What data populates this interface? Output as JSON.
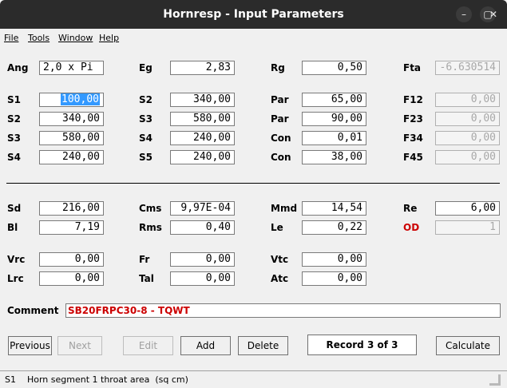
{
  "window": {
    "title": "Hornresp - Input Parameters",
    "controls": [
      "–",
      "▢",
      "✕"
    ]
  },
  "menu": [
    "File",
    "Tools",
    "Window",
    "Help"
  ],
  "params": {
    "Ang": "2,0 x Pi",
    "Eg": "2,83",
    "Rg": "0,50",
    "Fta": "-6.630514",
    "col1": [
      {
        "label": "S1",
        "value": "100,00"
      },
      {
        "label": "S2",
        "value": "340,00"
      },
      {
        "label": "S3",
        "value": "580,00"
      },
      {
        "label": "S4",
        "value": "240,00"
      }
    ],
    "col2": [
      {
        "label": "S2",
        "value": "340,00"
      },
      {
        "label": "S3",
        "value": "580,00"
      },
      {
        "label": "S4",
        "value": "240,00"
      },
      {
        "label": "S5",
        "value": "240,00"
      }
    ],
    "col3": [
      {
        "label": "Par",
        "value": "65,00"
      },
      {
        "label": "Par",
        "value": "90,00"
      },
      {
        "label": "Con",
        "value": "0,01"
      },
      {
        "label": "Con",
        "value": "38,00"
      }
    ],
    "col4": [
      {
        "label": "F12",
        "value": "0,00"
      },
      {
        "label": "F23",
        "value": "0,00"
      },
      {
        "label": "F34",
        "value": "0,00"
      },
      {
        "label": "F45",
        "value": "0,00"
      }
    ]
  },
  "driver": {
    "Sd": "216,00",
    "Cms": "9,97E-04",
    "Mmd": "14,54",
    "Re": "6,00",
    "Bl": "7,19",
    "Rms": "0,40",
    "Le": "0,22",
    "OD": "1"
  },
  "chamber": {
    "Vrc": "0,00",
    "Fr": "0,00",
    "Vtc": "0,00",
    "Lrc": "0,00",
    "Tal": "0,00",
    "Atc": "0,00"
  },
  "comment": {
    "label": "Comment",
    "value": "SB20FRPC30-8 - TQWT"
  },
  "buttons": {
    "previous": "Previous",
    "next": "Next",
    "edit": "Edit",
    "add": "Add",
    "delete": "Delete",
    "record": "Record 3 of 3",
    "calculate": "Calculate"
  },
  "status": "S1    Horn segment 1 throat area  (sq cm)"
}
